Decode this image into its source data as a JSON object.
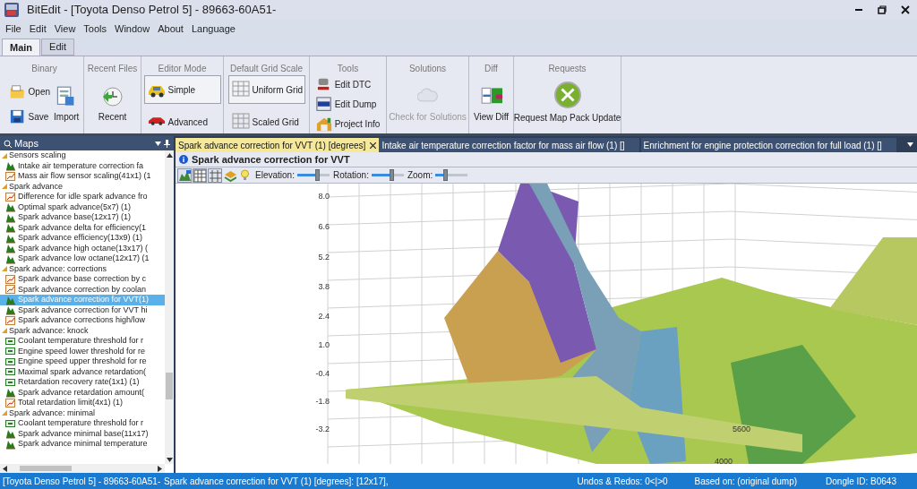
{
  "window": {
    "title": "BitEdit - [Toyota Denso Petrol 5] - 89663-60A51-"
  },
  "menu": [
    "File",
    "Edit",
    "View",
    "Tools",
    "Window",
    "About",
    "Language"
  ],
  "ribbon_tabs": [
    {
      "label": "Main",
      "selected": true
    },
    {
      "label": "Edit",
      "selected": false
    }
  ],
  "ribbon_groups": [
    {
      "title": "Binary",
      "buttons": [
        {
          "label": "Open",
          "kind": "open"
        },
        {
          "label": "Save",
          "kind": "save"
        },
        {
          "label": "Import",
          "kind": "import"
        }
      ]
    },
    {
      "title": "Recent Files",
      "buttons": [
        {
          "label": "Recent",
          "kind": "recent"
        }
      ]
    },
    {
      "title": "Editor Mode",
      "buttons": [
        {
          "label": "Simple",
          "kind": "simple",
          "selected": true
        },
        {
          "label": "Advanced",
          "kind": "advanced",
          "selected": false
        }
      ]
    },
    {
      "title": "Default Grid Scale",
      "buttons": [
        {
          "label": "Uniform Grid",
          "kind": "grid",
          "selected": true
        },
        {
          "label": "Scaled Grid",
          "kind": "grid",
          "selected": false
        }
      ]
    },
    {
      "title": "Tools",
      "buttons": [
        {
          "label": "Edit DTC",
          "kind": "dtc"
        },
        {
          "label": "Edit Dump",
          "kind": "hex"
        },
        {
          "label": "Project Info",
          "kind": "info"
        }
      ]
    },
    {
      "title": "Solutions",
      "buttons": [
        {
          "label": "Check for Solutions",
          "kind": "solutions",
          "disabled": true
        }
      ]
    },
    {
      "title": "Diff",
      "buttons": [
        {
          "label": "View Diff",
          "kind": "diff"
        }
      ]
    },
    {
      "title": "Requests",
      "buttons": [
        {
          "label": "Request Map Pack Update",
          "kind": "request"
        }
      ]
    }
  ],
  "maps_panel": {
    "title": "Maps",
    "tree": [
      {
        "label": "Sensors scaling",
        "children": [
          {
            "label": "Intake air temperature correction fa",
            "kind": "map3d",
            "selected": false
          },
          {
            "label": "Mass air flow sensor scaling(41x1) (1",
            "kind": "map2d",
            "selected": false
          }
        ]
      },
      {
        "label": "Spark advance",
        "children": [
          {
            "label": "Difference for idle spark advance fro",
            "kind": "map2d",
            "selected": false
          },
          {
            "label": "Optimal spark advance(5x7) (1)",
            "kind": "map3d",
            "selected": false
          },
          {
            "label": "Spark advance base(12x17) (1)",
            "kind": "map3d",
            "selected": false
          },
          {
            "label": "Spark advance delta for efficiency(1",
            "kind": "map3d",
            "selected": false
          },
          {
            "label": "Spark advance efficiency(13x9) (1)",
            "kind": "map3d",
            "selected": false
          },
          {
            "label": "Spark advance high octane(13x17) (",
            "kind": "map3d",
            "selected": false
          },
          {
            "label": "Spark advance low octane(12x17) (1",
            "kind": "map3d",
            "selected": false
          }
        ]
      },
      {
        "label": "Spark advance: corrections",
        "children": [
          {
            "label": "Spark advance base correction by c",
            "kind": "map2d",
            "selected": false
          },
          {
            "label": "Spark advance correction by coolan",
            "kind": "map2d",
            "selected": false
          },
          {
            "label": "Spark advance correction for VVT(1)",
            "kind": "map3d",
            "selected": true
          },
          {
            "label": "Spark advance correction for VVT hi",
            "kind": "map3d",
            "selected": false
          },
          {
            "label": "Spark advance corrections high/low",
            "kind": "map2d",
            "selected": false
          }
        ]
      },
      {
        "label": "Spark advance: knock",
        "children": [
          {
            "label": "Coolant temperature threshold for r",
            "kind": "value",
            "selected": false
          },
          {
            "label": "Engine speed lower threshold for re",
            "kind": "value",
            "selected": false
          },
          {
            "label": "Engine speed upper threshold for re",
            "kind": "value",
            "selected": false
          },
          {
            "label": "Maximal spark advance retardation(",
            "kind": "value",
            "selected": false
          },
          {
            "label": "Retardation recovery rate(1x1) (1)",
            "kind": "value",
            "selected": false
          },
          {
            "label": "Spark advance retardation amount(",
            "kind": "map3d",
            "selected": false
          },
          {
            "label": "Total retardation limit(4x1) (1)",
            "kind": "map2d",
            "selected": false
          }
        ]
      },
      {
        "label": "Spark advance: minimal",
        "children": [
          {
            "label": "Coolant temperature threshold for r",
            "kind": "value",
            "selected": false
          },
          {
            "label": "Spark advance minimal base(11x17)",
            "kind": "map3d",
            "selected": false
          },
          {
            "label": "Spark advance minimal temperature",
            "kind": "map3d",
            "selected": false
          }
        ]
      }
    ]
  },
  "doc_tabs": [
    {
      "label": "Spark advance correction for VVT (1) [degrees]",
      "selected": true
    },
    {
      "label": "Intake air temperature correction factor for mass air flow (1) []",
      "selected": false
    },
    {
      "label": "Enrichment for engine protection correction for full load (1) []",
      "selected": false
    }
  ],
  "editor": {
    "title": "Spark advance correction for VVT",
    "sliders": [
      {
        "label": "Elevation:",
        "level": 0.6
      },
      {
        "label": "Rotation:",
        "level": 0.6
      },
      {
        "label": "Zoom:",
        "level": 0.3
      }
    ],
    "value_ticks": [
      "8.0",
      "6.6",
      "5.2",
      "3.8",
      "2.4",
      "1.0",
      "-0.4",
      "-1.8",
      "-3.2"
    ],
    "rpm_ticks": [
      "5600",
      "4000"
    ]
  },
  "status_bar": {
    "project": "[Toyota Denso Petrol 5] - 89663-60A51-",
    "map": "Spark advance correction for VVT (1) [degrees]: [12x17],",
    "undo": "Undos & Redos: 0<|>0",
    "based_on": "Based on: (original dump)",
    "dongle": "Dongle ID: B0643"
  }
}
